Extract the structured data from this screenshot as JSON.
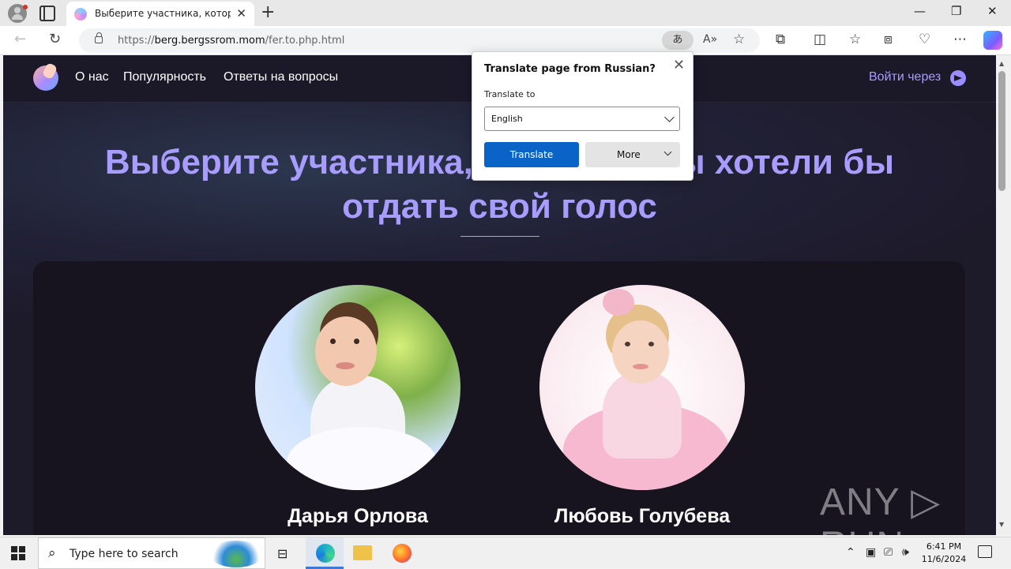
{
  "browser": {
    "tab_title": "Выберите участника, которому",
    "url_prefix": "https://",
    "url_host": "berg.bergssrom.mom",
    "url_path": "/fer.to.php.html"
  },
  "site": {
    "nav": [
      {
        "label": "О нас"
      },
      {
        "label": "Популярность"
      },
      {
        "label": "Ответы на вопросы"
      }
    ],
    "login_label": "Войти через",
    "headline": "Выберите участника, которому вы хотели бы отдать свой голос",
    "contestants": [
      {
        "name": "Дарья Орлова"
      },
      {
        "name": "Любовь Голубева"
      }
    ]
  },
  "translate_popup": {
    "title": "Translate page from Russian?",
    "label": "Translate to",
    "selected_language": "English",
    "translate_button": "Translate",
    "more_button": "More"
  },
  "watermark": "ANY ▷ RUN",
  "taskbar": {
    "search_placeholder": "Type here to search",
    "time": "6:41 PM",
    "date": "11/6/2024"
  },
  "colors": {
    "accent": "#a99cff",
    "page_bg": "#1d1a2a",
    "translate_button": "#0a64c8"
  }
}
